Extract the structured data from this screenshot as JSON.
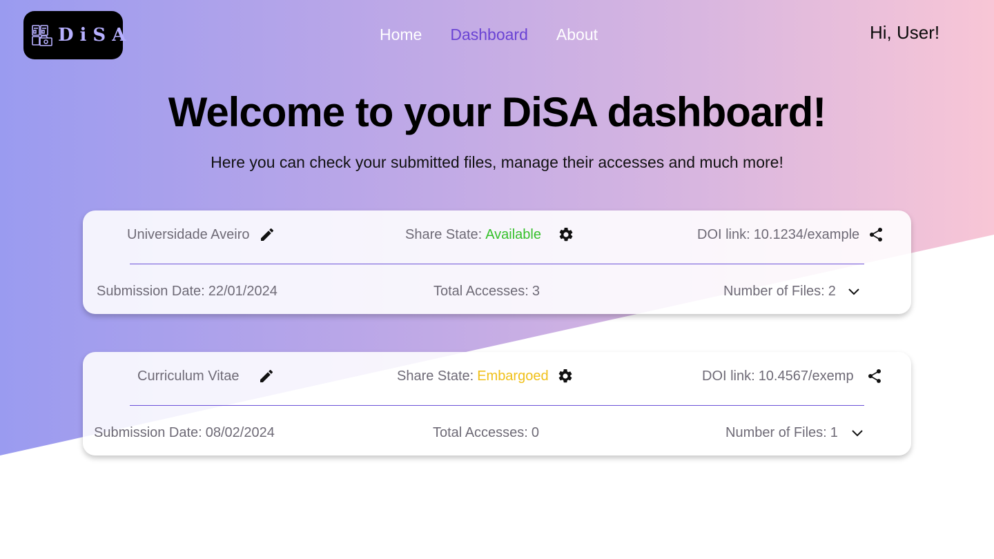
{
  "header": {
    "logo_text": "DiSA",
    "nav": [
      {
        "label": "Home",
        "active": false
      },
      {
        "label": "Dashboard",
        "active": true
      },
      {
        "label": "About",
        "active": false
      }
    ],
    "greeting": "Hi, User!"
  },
  "hero": {
    "title": "Welcome to your DiSA dashboard!",
    "subtitle": "Here you can check your submitted files, manage their accesses and much more!"
  },
  "submissions": [
    {
      "name": "Universidade Aveiro",
      "share_state_label": "Share State:",
      "share_state": "Available",
      "doi_label": "DOI link:",
      "doi": "10.1234/example",
      "submission_date_label": "Submission Date:",
      "submission_date": "22/01/2024",
      "total_accesses_label": "Total Accesses:",
      "total_accesses": "3",
      "files_label": "Number of Files:",
      "files": "2"
    },
    {
      "name": "Curriculum Vitae",
      "share_state_label": "Share State:",
      "share_state": "Embargoed",
      "doi_label": "DOI link:",
      "doi": "10.4567/exemp",
      "submission_date_label": "Submission Date:",
      "submission_date": "08/02/2024",
      "total_accesses_label": "Total Accesses:",
      "total_accesses": "0",
      "files_label": "Number of Files:",
      "files": "1"
    }
  ],
  "colors": {
    "accent": "#6a43d4",
    "available": "#35c02a",
    "embargoed": "#f0c019"
  },
  "icons": [
    "archive-icon",
    "edit-icon",
    "gear-icon",
    "share-icon",
    "chevron-down-icon"
  ]
}
